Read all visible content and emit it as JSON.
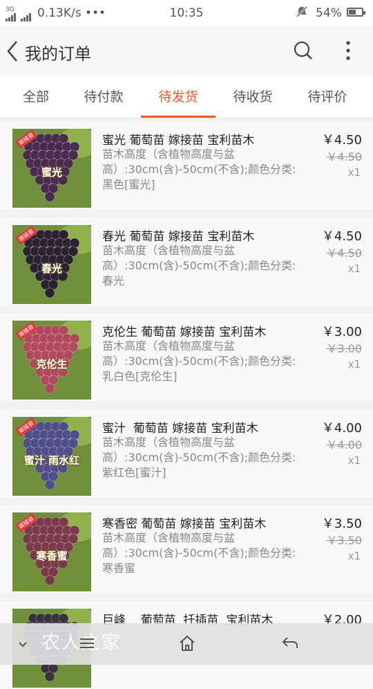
{
  "status_bar": {
    "signal_left": "3G",
    "signal_right": "3G",
    "speed": "0.13K/s •••",
    "time": "10:35",
    "mute_icon": "bell-mute-icon",
    "battery": "54%",
    "battery_level": 0.54
  },
  "header": {
    "title": "我的订单",
    "back_icon": "chevron-left-icon",
    "search_icon": "search-icon",
    "more_icon": "more-vertical-icon"
  },
  "tabs": [
    {
      "label": "全部"
    },
    {
      "label": "待付款"
    },
    {
      "label": "待发货"
    },
    {
      "label": "待收货"
    },
    {
      "label": "待评价"
    }
  ],
  "active_tab": "待发货",
  "accent_color": "#f05a23",
  "orders": [
    {
      "name": "蜜光 葡萄苗 嫁接苗 宝利苗木",
      "desc": "苗木高度（含植物高度与盆高）:30cm(含)-50cm(不含);颜色分类:黑色[蜜光]",
      "price": "￥4.50",
      "original_price": "￥4.50",
      "qty": "x1",
      "image_label": "蜜光",
      "image_ribbon": "嫁接苗",
      "grape_color": "#4a2a4f"
    },
    {
      "name": "春光 葡萄苗 嫁接苗 宝利苗木",
      "desc": "苗木高度（含植物高度与盆高）:30cm(含)-50cm(不含);颜色分类:春光",
      "price": "￥4.50",
      "original_price": "￥4.50",
      "qty": "x1",
      "image_label": "春光",
      "image_ribbon": "嫁接苗",
      "grape_color": "#2a2230"
    },
    {
      "name": "克伦生 葡萄苗 嫁接苗 宝利苗木",
      "desc": "苗木高度（含植物高度与盆高）:30cm(含)-50cm(不含);颜色分类:乳白色[克伦生]",
      "price": "￥3.00",
      "original_price": "￥3.00",
      "qty": "x1",
      "image_label": "克伦生",
      "image_ribbon": "嫁接苗",
      "grape_color": "#b2485e"
    },
    {
      "name": "蜜汁  葡萄苗 嫁接苗 宝利苗木",
      "desc": "苗木高度（含植物高度与盆高）:30cm(含)-50cm(不含);颜色分类:紫红色[蜜汁]",
      "price": "￥4.00",
      "original_price": "￥4.00",
      "qty": "x1",
      "image_label": "蜜汁 雨水红",
      "image_ribbon": "嫁接苗",
      "grape_color": "#4e4e8a"
    },
    {
      "name": "寒香密 葡萄苗 嫁接苗 宝利苗木",
      "desc": "苗木高度（含植物高度与盆高）:30cm(含)-50cm(不含);颜色分类:寒香蜜",
      "price": "￥3.50",
      "original_price": "￥3.50",
      "qty": "x1",
      "image_label": "寒香蜜",
      "image_ribbon": "嫁接苗",
      "grape_color": "#7a3a4c"
    },
    {
      "name": "巨峰    葡萄苗  扦插苗  宝利苗木",
      "desc": "",
      "price": "￥2.00",
      "original_price": "",
      "qty": "",
      "image_label": "",
      "image_ribbon": "",
      "grape_color": "#3a3040"
    }
  ],
  "nav_bar": {
    "collapse_icon": "chevron-down-icon",
    "menu_icon": "menu-icon",
    "home_icon": "home-icon",
    "back_icon": "back-arrow-icon",
    "watermark": "农人之家"
  }
}
